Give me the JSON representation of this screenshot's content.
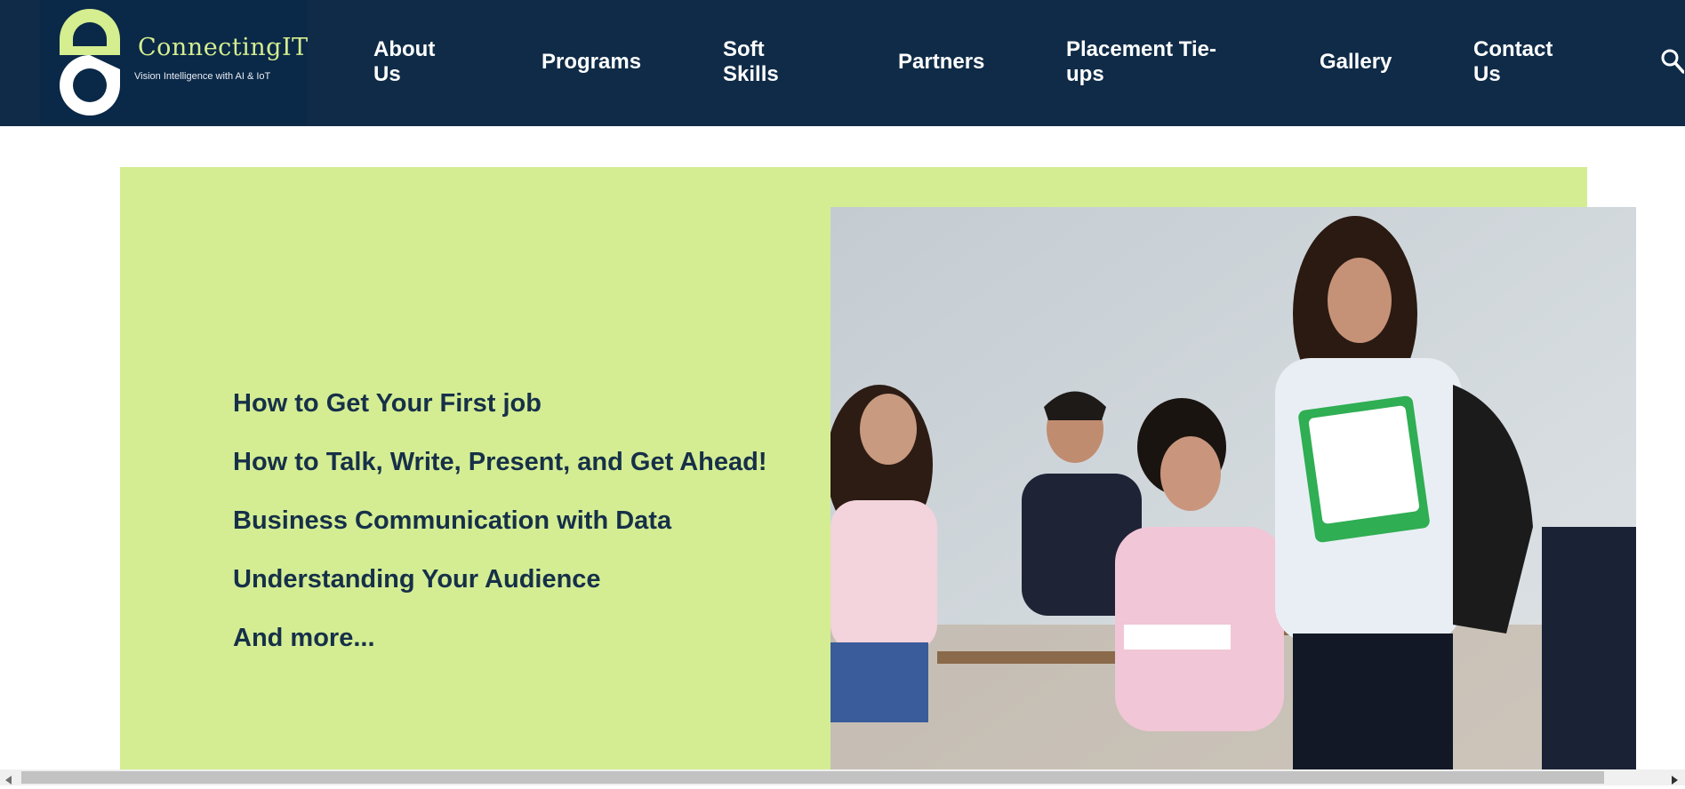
{
  "header": {
    "brand_name": "ConnectingIT",
    "tagline": "Vision Intelligence with AI & IoT",
    "nav": [
      {
        "label_line1": "About",
        "label_line2": "Us"
      },
      {
        "label_line1": "Programs",
        "label_line2": ""
      },
      {
        "label_line1": "Soft",
        "label_line2": "Skills"
      },
      {
        "label_line1": "Partners",
        "label_line2": ""
      },
      {
        "label_line1": "Placement Tie-",
        "label_line2": "ups"
      },
      {
        "label_line1": "Gallery",
        "label_line2": ""
      },
      {
        "label_line1": "Contact",
        "label_line2": "Us"
      }
    ],
    "search_icon": "search-icon"
  },
  "hero": {
    "topics": [
      "How to Get Your First job",
      "How to Talk, Write, Present, and Get Ahead!",
      "Business Communication with Data",
      "Understanding Your Audience",
      "And more..."
    ]
  },
  "colors": {
    "header_bg": "#0f2b47",
    "accent_green": "#d4ed93",
    "text_dark": "#163049"
  }
}
